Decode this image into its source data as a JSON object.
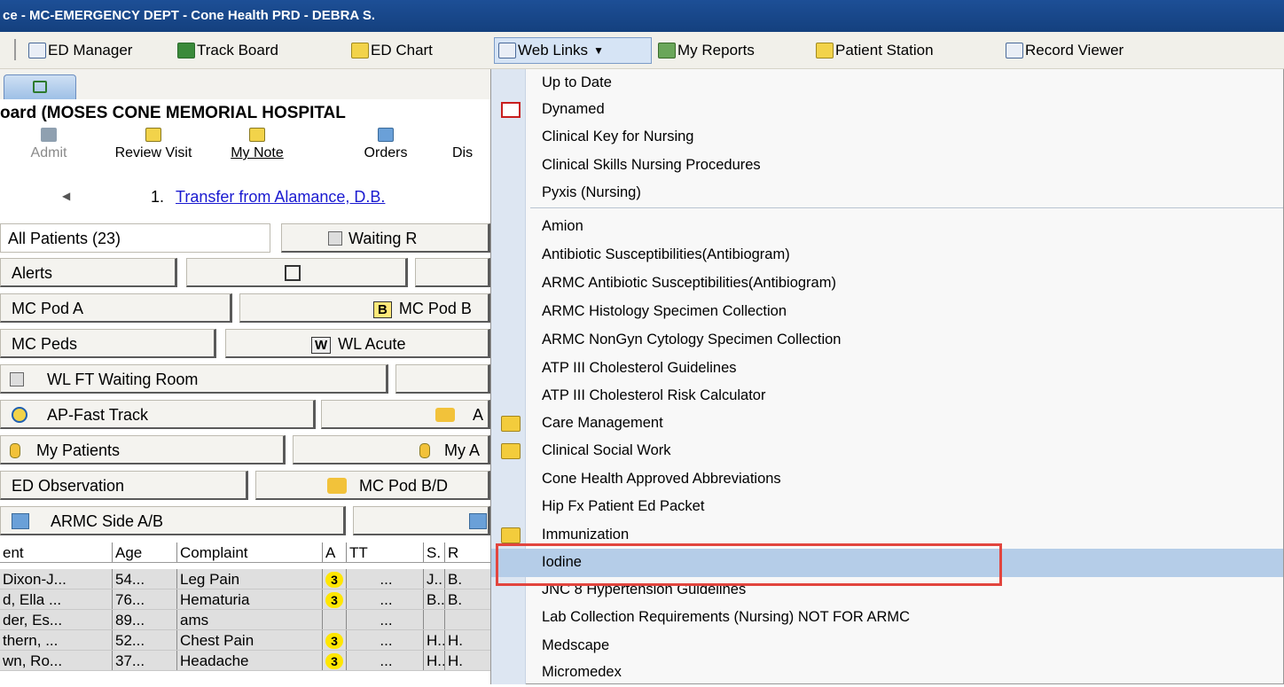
{
  "window_title": "ce - MC-EMERGENCY DEPT - Cone Health PRD - DEBRA S.",
  "toolbar": {
    "items": [
      "ED Manager",
      "Track Board",
      "ED Chart",
      "Web Links",
      "My Reports",
      "Patient Station",
      "Record Viewer"
    ]
  },
  "board": {
    "title": "oard (MOSES CONE MEMORIAL HOSPITAL"
  },
  "actions": [
    "Admit",
    "Review Visit",
    "My Note",
    "Orders",
    "Dis"
  ],
  "nav": {
    "prefix": "1.",
    "link": "Transfer from Alamance, D.B."
  },
  "filters": [
    [
      "All Patients (23)",
      "Waiting R"
    ],
    [
      "Alerts",
      "",
      ""
    ],
    [
      "MC Pod A",
      "MC Pod B"
    ],
    [
      "MC Peds",
      "WL Acute"
    ],
    [
      "WL FT Waiting Room",
      ""
    ],
    [
      "AP-Fast Track",
      "A"
    ],
    [
      "My Patients",
      "My A"
    ],
    [
      "ED Observation",
      "MC Pod B/D"
    ],
    [
      "ARMC Side A/B",
      ""
    ]
  ],
  "badges": {
    "pod_b": "B",
    "wl_acute": "W"
  },
  "grid": {
    "columns": [
      "ent",
      "Age",
      "Complaint",
      "A",
      "TT",
      "S.",
      "R"
    ],
    "rows": [
      [
        "Dixon-J...",
        "54...",
        "Leg Pain",
        "3",
        "...",
        "J..",
        "B."
      ],
      [
        "d, Ella ...",
        "76...",
        "Hematuria",
        "3",
        "...",
        "B..",
        "B."
      ],
      [
        "der, Es...",
        "89...",
        "ams",
        "",
        "...",
        "",
        ""
      ],
      [
        "thern, ...",
        "52...",
        "Chest Pain",
        "3",
        "...",
        "H..",
        "H."
      ],
      [
        "wn, Ro...",
        "37...",
        "Headache",
        "3",
        "...",
        "H..",
        "H."
      ]
    ]
  },
  "web_links_menu": {
    "items": [
      {
        "label": "Up to Date",
        "icon": ""
      },
      {
        "label": "Dynamed",
        "icon": "dynamed-icon"
      },
      {
        "label": "Clinical Key for Nursing",
        "icon": ""
      },
      {
        "label": "Clinical Skills Nursing Procedures",
        "icon": ""
      },
      {
        "label": "Pyxis (Nursing)",
        "icon": ""
      },
      {
        "label": "Amion",
        "icon": ""
      },
      {
        "label": "Antibiotic Susceptibilities(Antibiogram)",
        "icon": ""
      },
      {
        "label": "ARMC Antibiotic Susceptibilities(Antibiogram)",
        "icon": ""
      },
      {
        "label": "ARMC Histology Specimen Collection",
        "icon": ""
      },
      {
        "label": "ARMC NonGyn Cytology Specimen Collection",
        "icon": ""
      },
      {
        "label": "ATP III Cholesterol Guidelines",
        "icon": ""
      },
      {
        "label": "ATP III Cholesterol Risk Calculator",
        "icon": ""
      },
      {
        "label": "Care Management",
        "icon": "folder-icon"
      },
      {
        "label": "Clinical Social Work",
        "icon": "folder-icon"
      },
      {
        "label": "Cone Health Approved Abbreviations",
        "icon": ""
      },
      {
        "label": "Hip Fx Patient Ed Packet",
        "icon": ""
      },
      {
        "label": "Immunization",
        "icon": "folder-icon"
      },
      {
        "label": "Iodine",
        "icon": "",
        "highlighted": true
      },
      {
        "label": "JNC 8 Hypertension Guidelines",
        "icon": ""
      },
      {
        "label": "Lab Collection Requirements (Nursing) NOT FOR ARMC",
        "icon": ""
      },
      {
        "label": "Medscape",
        "icon": ""
      },
      {
        "label": "Micromedex",
        "icon": ""
      }
    ]
  },
  "colors": {
    "title_bar": "#1d4f96",
    "menu_highlight": "#b5cde8",
    "annotation_box": "#e2453e",
    "acuity_badge": "#ffe600"
  }
}
